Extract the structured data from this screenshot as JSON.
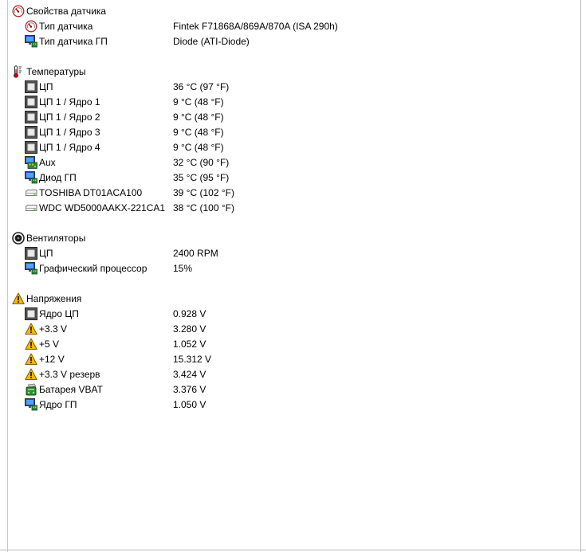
{
  "sections": [
    {
      "title": "Свойства датчика",
      "icon": "gauge-icon",
      "items": [
        {
          "label": "Тип датчика",
          "value": "Fintek F71868A/869A/870A  (ISA 290h)",
          "icon": "gauge-icon"
        },
        {
          "label": "Тип датчика ГП",
          "value": "Diode  (ATI-Diode)",
          "icon": "monitor-icon"
        }
      ]
    },
    {
      "title": "Температуры",
      "icon": "thermometer-icon",
      "items": [
        {
          "label": "ЦП",
          "value": "36 °C  (97 °F)",
          "icon": "cpu-chip-icon"
        },
        {
          "label": "ЦП 1 / Ядро 1",
          "value": "9 °C  (48 °F)",
          "icon": "cpu-chip-icon"
        },
        {
          "label": "ЦП 1 / Ядро 2",
          "value": "9 °C  (48 °F)",
          "icon": "cpu-chip-icon"
        },
        {
          "label": "ЦП 1 / Ядро 3",
          "value": "9 °C  (48 °F)",
          "icon": "cpu-chip-icon"
        },
        {
          "label": "ЦП 1 / Ядро 4",
          "value": "9 °C  (48 °F)",
          "icon": "cpu-chip-icon"
        },
        {
          "label": "Aux",
          "value": "32 °C  (90 °F)",
          "icon": "motherboard-icon"
        },
        {
          "label": "Диод ГП",
          "value": "35 °C  (95 °F)",
          "icon": "monitor-icon"
        },
        {
          "label": "TOSHIBA DT01ACA100",
          "value": "39 °C  (102 °F)",
          "icon": "hard-drive-icon"
        },
        {
          "label": "WDC WD5000AAKX-221CA1",
          "value": "38 °C  (100 °F)",
          "icon": "hard-drive-icon"
        }
      ]
    },
    {
      "title": "Вентиляторы",
      "icon": "fan-icon",
      "items": [
        {
          "label": "ЦП",
          "value": "2400 RPM",
          "icon": "cpu-chip-icon"
        },
        {
          "label": "Графический процессор",
          "value": "15%",
          "icon": "monitor-icon"
        }
      ]
    },
    {
      "title": "Напряжения",
      "icon": "warning-icon",
      "items": [
        {
          "label": "Ядро ЦП",
          "value": "0.928 V",
          "icon": "cpu-chip-icon"
        },
        {
          "label": "+3.3 V",
          "value": "3.280 V",
          "icon": "warning-icon"
        },
        {
          "label": "+5 V",
          "value": "1.052 V",
          "icon": "warning-icon"
        },
        {
          "label": "+12 V",
          "value": "15.312 V",
          "icon": "warning-icon"
        },
        {
          "label": "+3.3 V резерв",
          "value": "3.424 V",
          "icon": "warning-icon"
        },
        {
          "label": "Батарея VBAT",
          "value": "3.376 V",
          "icon": "battery-icon"
        },
        {
          "label": "Ядро ГП",
          "value": "1.050 V",
          "icon": "monitor-icon"
        }
      ]
    }
  ]
}
